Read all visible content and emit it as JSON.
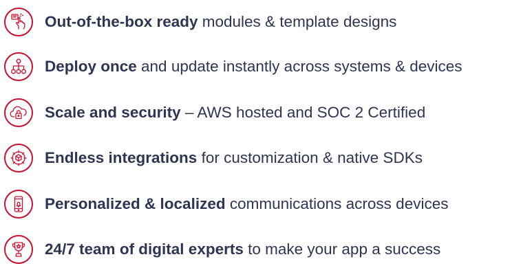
{
  "accent_color": "#c8102e",
  "text_color": "#2d3552",
  "features": [
    {
      "icon": "hand-tap-icon",
      "bold": "Out-of-the-box ready",
      "rest": " modules & template designs"
    },
    {
      "icon": "network-hierarchy-icon",
      "bold": "Deploy once",
      "rest": " and update instantly across systems & devices"
    },
    {
      "icon": "cloud-lock-icon",
      "bold": "Scale and security",
      "rest": " – AWS hosted and SOC 2 Certified"
    },
    {
      "icon": "integration-gear-icon",
      "bold": "Endless integrations",
      "rest": " for customization & native SDKs"
    },
    {
      "icon": "mobile-notification-icon",
      "bold": "Personalized & localized",
      "rest": " communications across devices"
    },
    {
      "icon": "trophy-icon",
      "bold": "24/7 team of digital experts",
      "rest": " to make your app a success"
    }
  ]
}
